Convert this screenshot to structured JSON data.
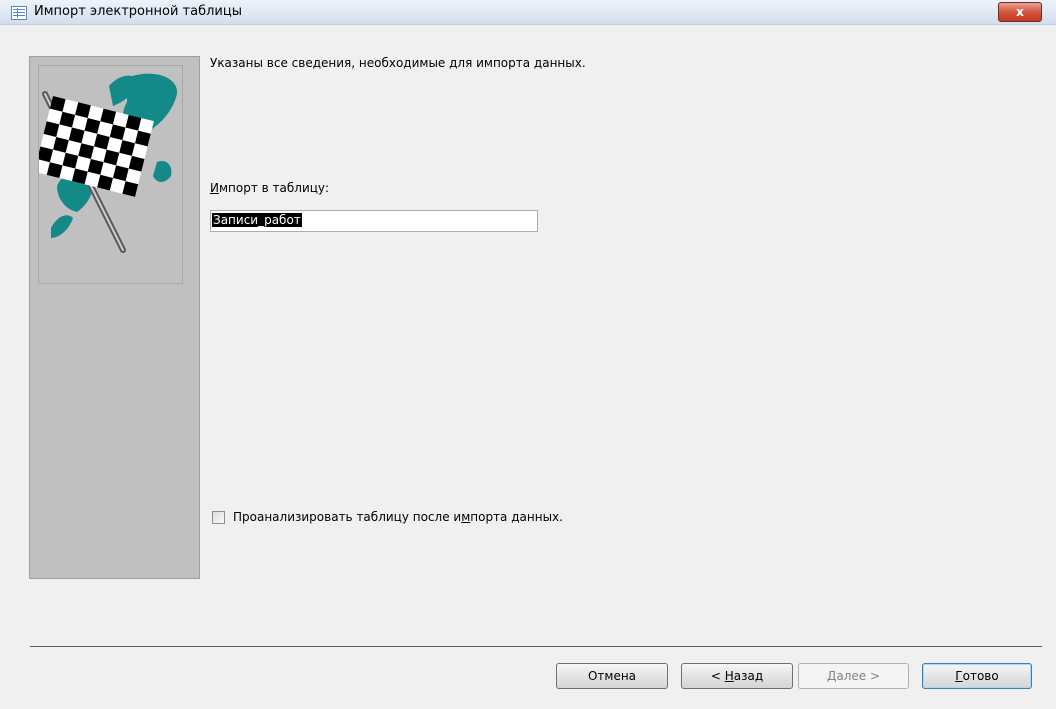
{
  "window": {
    "title": "Импорт электронной таблицы",
    "close_label": "x"
  },
  "main": {
    "info": "Указаны все сведения, необходимые для импорта данных.",
    "import_label_prefix": "И",
    "import_label_rest": "мпорт в таблицу:",
    "table_name": "Записи_работ",
    "analyze_prefix": "Проанализировать таблицу после и",
    "analyze_mnemonic": "м",
    "analyze_rest": "порта данных.",
    "analyze_checked": false
  },
  "buttons": {
    "cancel": "Отмена",
    "back_prefix": "< ",
    "back_mnemonic": "Н",
    "back_rest": "азад",
    "next_mnemonic": "Д",
    "next_rest": "алее >",
    "finish_mnemonic": "Г",
    "finish_rest": "отово"
  },
  "icons": {
    "window_icon": "table-icon",
    "close": "close-icon",
    "wizard_art": "checkered-flag-icon"
  },
  "colors": {
    "accent_teal": "#148a88",
    "close_red": "#c13b26",
    "panel_gray": "#c0c0c0"
  }
}
